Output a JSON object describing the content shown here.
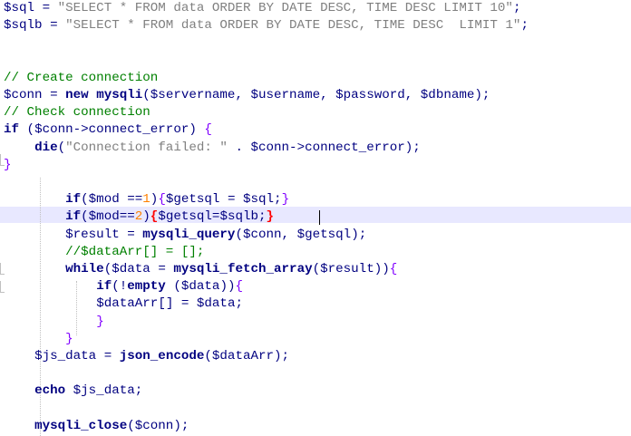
{
  "editor": {
    "language": "PHP",
    "lines": [
      {
        "line": "$sql = \"SELECT * FROM data ORDER BY DATE DESC, TIME DESC LIMIT 10\";"
      },
      {
        "line": "$sqlb = \"SELECT * FROM data ORDER BY DATE DESC, TIME DESC  LIMIT 1\";"
      },
      {
        "line": ""
      },
      {
        "line": ""
      },
      {
        "line": "// Create connection"
      },
      {
        "line": "$conn = new mysqli($servername, $username, $password, $dbname);"
      },
      {
        "line": "// Check connection"
      },
      {
        "line": "if ($conn->connect_error) {"
      },
      {
        "line": "    die(\"Connection failed: \" . $conn->connect_error);"
      },
      {
        "line": "}"
      },
      {
        "line": ""
      },
      {
        "line": "        if($mod ==1){$getsql = $sql;}"
      },
      {
        "line": "        if($mod==2){$getsql=$sqlb;}"
      },
      {
        "line": "        $result = mysqli_query($conn, $getsql);"
      },
      {
        "line": "        //$dataArr[] = [];"
      },
      {
        "line": "        while($data = mysqli_fetch_array($result)){"
      },
      {
        "line": "            if(!empty ($data)){"
      },
      {
        "line": "            $dataArr[] = $data;"
      },
      {
        "line": "            }"
      },
      {
        "line": "        }"
      },
      {
        "line": "    $js_data = json_encode($dataArr);"
      },
      {
        "line": ""
      },
      {
        "line": "    echo $js_data;"
      },
      {
        "line": ""
      },
      {
        "line": "    mysqli_close($conn);"
      }
    ],
    "colors": {
      "background": "#ffffff",
      "current_line": "#e8e8ff",
      "variable": "#000080",
      "string": "#808080",
      "comment": "#008000",
      "number": "#ff8000",
      "brace": "#8000ff",
      "matched_brace": "#ff0000"
    }
  }
}
